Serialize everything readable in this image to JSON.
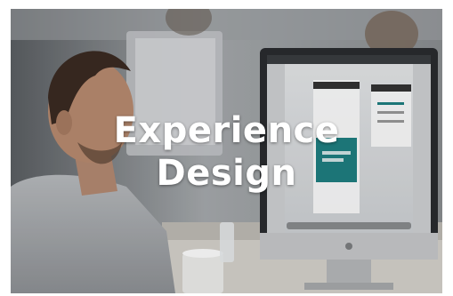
{
  "hero": {
    "title_line_1": "Experience",
    "title_line_2": "Design"
  },
  "colors": {
    "title_text": "#ffffff",
    "screen_accent": "#1f7f82"
  }
}
